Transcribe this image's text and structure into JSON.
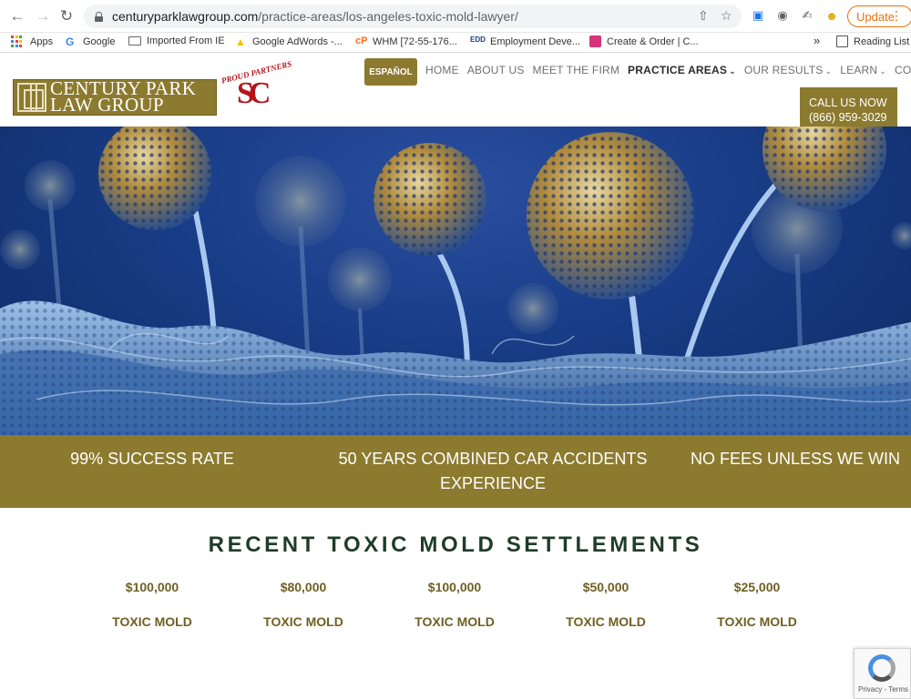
{
  "browser": {
    "url_host": "centuryparklawgroup.com",
    "url_path": "/practice-areas/los-angeles-toxic-mold-lawyer/",
    "update_label": "Update",
    "bookmarks": [
      {
        "label": "Apps",
        "icon": "apps-grid-icon"
      },
      {
        "label": "Google",
        "icon": "google-icon"
      },
      {
        "label": "Imported From IE",
        "icon": "folder-icon"
      },
      {
        "label": "Google AdWords -...",
        "icon": "adwords-icon"
      },
      {
        "label": "WHM [72-55-176...",
        "icon": "whm-icon"
      },
      {
        "label": "Employment Deve...",
        "icon": "edd-icon"
      },
      {
        "label": "Create & Order | C...",
        "icon": "create-order-icon"
      }
    ],
    "more_bookmarks": "»",
    "reading_list": "Reading List"
  },
  "header": {
    "logo_line1": "CENTURY PARK",
    "logo_line2": "LAW GROUP",
    "partners_text": "PROUD PARTNERS",
    "espanol_label": "ESPAÑOL",
    "nav": [
      {
        "label": "HOME",
        "dropdown": false
      },
      {
        "label": "ABOUT US",
        "dropdown": false
      },
      {
        "label": "MEET THE FIRM",
        "dropdown": false
      },
      {
        "label": "PRACTICE AREAS",
        "dropdown": true,
        "active": true
      },
      {
        "label": "OUR RESULTS",
        "dropdown": true
      },
      {
        "label": "LEARN",
        "dropdown": true
      },
      {
        "label": "CONTACT",
        "dropdown": false
      }
    ],
    "call_label": "CALL US NOW",
    "call_number": "(866) 959-3029"
  },
  "stats": {
    "success": "99% SUCCESS RATE",
    "experience_line1": "50 YEARS COMBINED CAR ACCIDENTS",
    "experience_line2": "EXPERIENCE",
    "fees": "NO FEES UNLESS WE WIN"
  },
  "settlements": {
    "title": "RECENT TOXIC MOLD SETTLEMENTS",
    "items": [
      {
        "amount": "$100,000",
        "label": "TOXIC MOLD"
      },
      {
        "amount": "$80,000",
        "label": "TOXIC MOLD"
      },
      {
        "amount": "$100,000",
        "label": "TOXIC MOLD"
      },
      {
        "amount": "$50,000",
        "label": "TOXIC MOLD"
      },
      {
        "amount": "$25,000",
        "label": "TOXIC MOLD"
      }
    ]
  },
  "recaptcha": {
    "footer": "Privacy - Terms"
  },
  "colors": {
    "brand_gold": "#8c7a2f",
    "title_green": "#1f3c2a",
    "amount_gold": "#6f5f22"
  }
}
